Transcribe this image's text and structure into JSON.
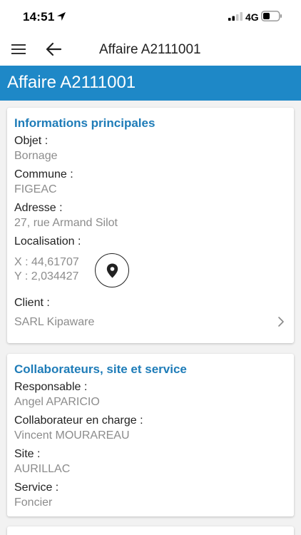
{
  "status_bar": {
    "time": "14:51",
    "network": "4G"
  },
  "nav": {
    "title": "Affaire A2111001"
  },
  "banner": {
    "title": "Affaire A2111001"
  },
  "main_info": {
    "title": "Informations principales",
    "objet_label": "Objet :",
    "objet_value": "Bornage",
    "commune_label": "Commune :",
    "commune_value": "FIGEAC",
    "adresse_label": "Adresse :",
    "adresse_value": "27, rue Armand Silot",
    "localisation_label": "Localisation :",
    "x_coord": "X : 44,61707",
    "y_coord": "Y :  2,034427",
    "client_label": "Client :",
    "client_value": "SARL Kipaware"
  },
  "collaborators": {
    "title": "Collaborateurs, site et service",
    "responsable_label": "Responsable :",
    "responsable_value": "Angel APARICIO",
    "collab_label": "Collaborateur en charge :",
    "collab_value": "Vincent MOURAREAU",
    "site_label": "Site :",
    "site_value": "AURILLAC",
    "service_label": "Service :",
    "service_value": "Foncier"
  },
  "colors": {
    "accent": "#1e88c7",
    "section_title": "#1e7cb8",
    "value_text": "#8c8c8c"
  }
}
